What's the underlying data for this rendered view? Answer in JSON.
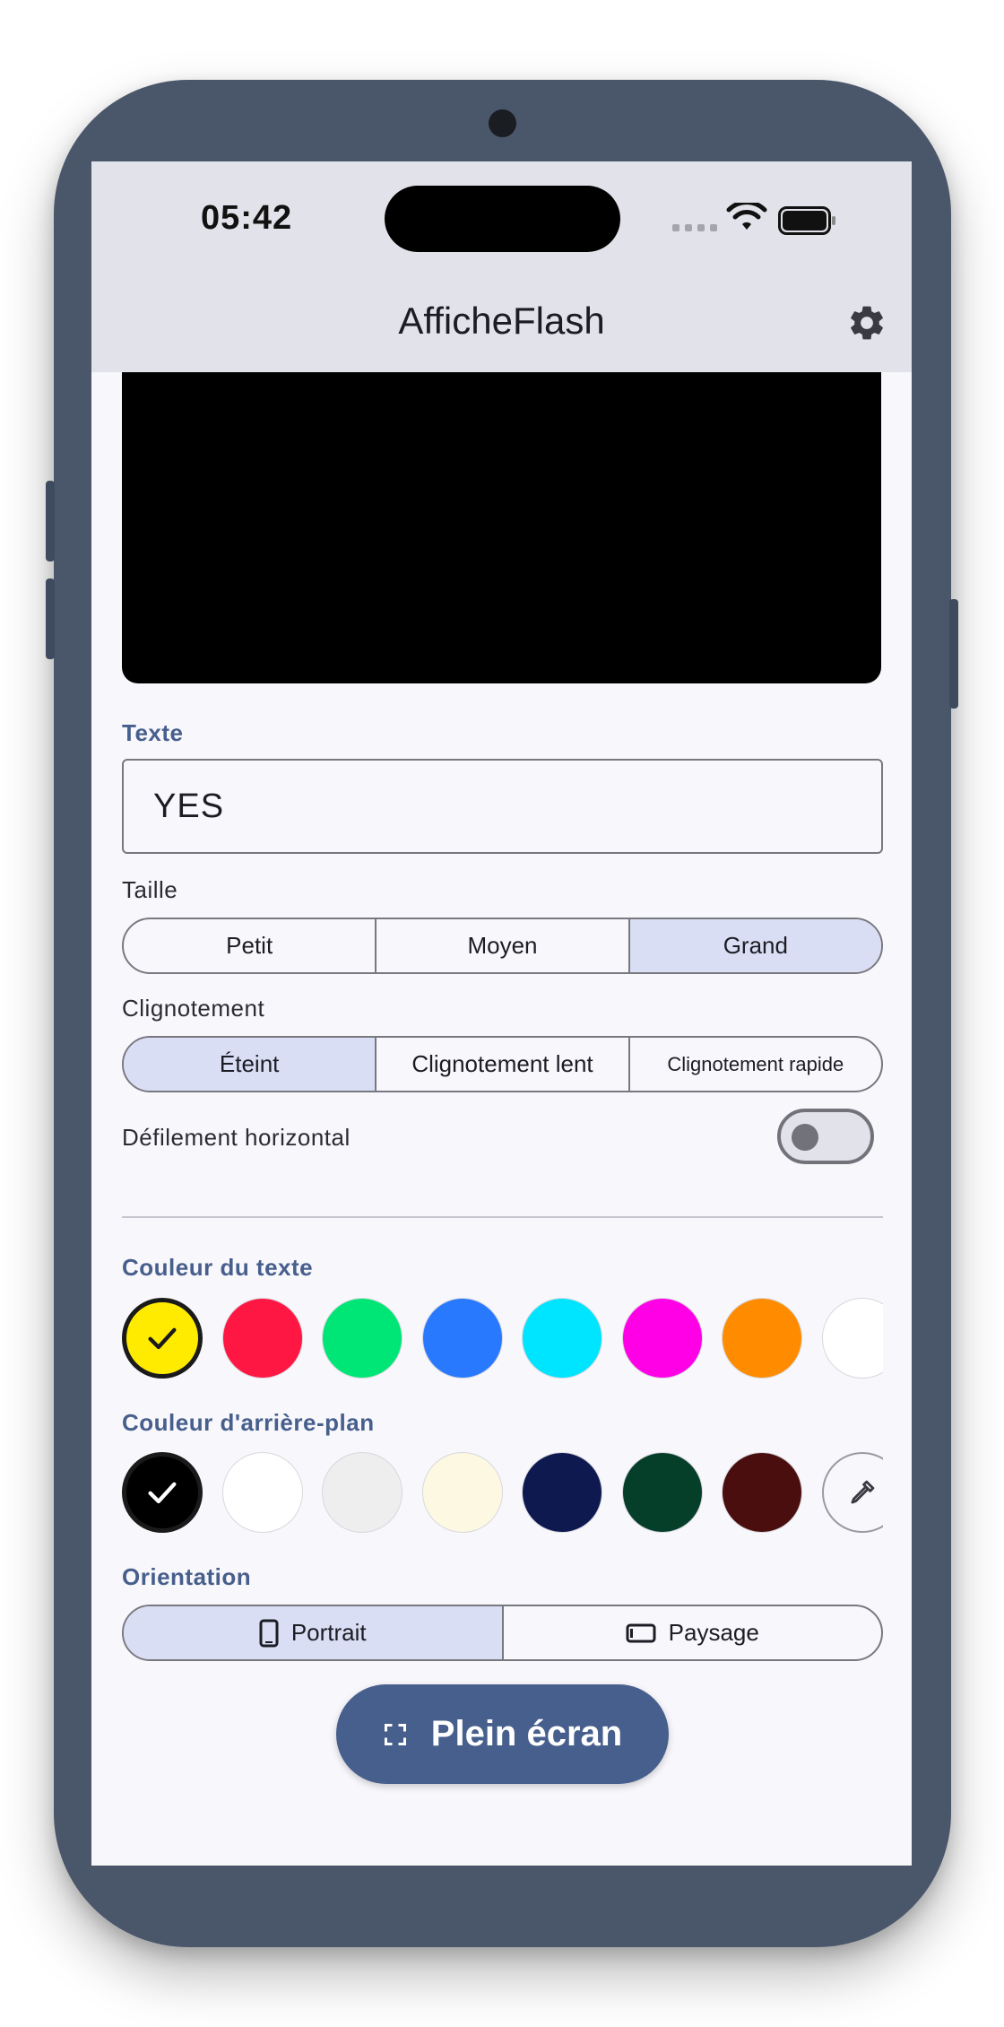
{
  "status_bar": {
    "time": "05:42"
  },
  "app_bar": {
    "title": "AfficheFlash",
    "settings_icon": "gear-icon"
  },
  "text_section": {
    "label": "Texte",
    "value": "YES"
  },
  "size_section": {
    "label": "Taille",
    "options": [
      "Petit",
      "Moyen",
      "Grand"
    ],
    "selected": "Grand"
  },
  "blink_section": {
    "label": "Clignotement",
    "options": [
      "Éteint",
      "Clignotement lent",
      "Clignotement rapide"
    ],
    "selected": "Éteint"
  },
  "scroll_section": {
    "label": "Défilement horizontal",
    "enabled": false
  },
  "text_color_section": {
    "label": "Couleur du texte",
    "colors": [
      "#FFEB00",
      "#FF1744",
      "#00E676",
      "#2979FF",
      "#00E5FF",
      "#FF00E6",
      "#FF8C00",
      "#FFFFFF"
    ],
    "selected": "#FFEB00"
  },
  "bg_color_section": {
    "label": "Couleur d'arrière-plan",
    "colors": [
      "#000000",
      "#FFFFFF",
      "#EEEEEE",
      "#FDF8E2",
      "#0E1A4F",
      "#053F29",
      "#4A0E0E"
    ],
    "picker_icon": "eyedropper-icon",
    "selected": "#000000"
  },
  "orientation_section": {
    "label": "Orientation",
    "options": [
      "Portrait",
      "Paysage"
    ],
    "selected": "Portrait",
    "option_icons": [
      "phone-portrait-icon",
      "phone-landscape-icon"
    ]
  },
  "fullscreen_button": {
    "label": "Plein écran",
    "icon": "fullscreen-icon"
  },
  "colors": {
    "accent": "#475F8C",
    "selected_segment": "#D9DEF4",
    "frame": "#4A566A"
  }
}
